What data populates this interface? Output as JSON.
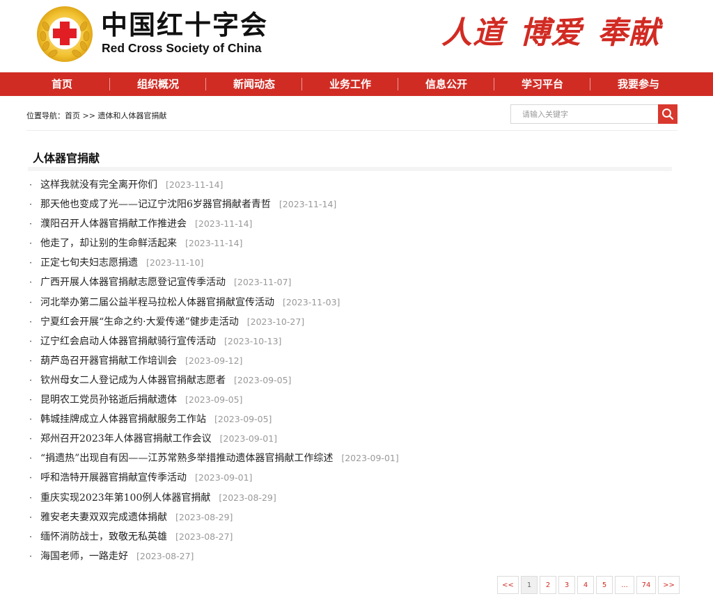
{
  "header": {
    "logo_cn": "中国红十字会",
    "logo_en": "Red Cross Society of China",
    "slogan": [
      "人道",
      "博爱",
      "奉献"
    ]
  },
  "nav": [
    "首页",
    "组织概况",
    "新闻动态",
    "业务工作",
    "信息公开",
    "学习平台",
    "我要参与"
  ],
  "breadcrumb": "位置导航：首页 >> 遗体和人体器官捐献",
  "search": {
    "placeholder": "请输入关键字"
  },
  "section_title": "人体器官捐献",
  "items": [
    {
      "title": "这样我就没有完全离开你们",
      "date": "[2023-11-14]"
    },
    {
      "title": "那天他也变成了光——记辽宁沈阳6岁器官捐献者青哲",
      "date": "[2023-11-14]"
    },
    {
      "title": "濮阳召开人体器官捐献工作推进会",
      "date": "[2023-11-14]"
    },
    {
      "title": "他走了，却让别的生命鲜活起来",
      "date": "[2023-11-14]"
    },
    {
      "title": "正定七旬夫妇志愿捐遗",
      "date": "[2023-11-10]"
    },
    {
      "title": "广西开展人体器官捐献志愿登记宣传季活动",
      "date": "[2023-11-07]"
    },
    {
      "title": "河北举办第二届公益半程马拉松人体器官捐献宣传活动",
      "date": "[2023-11-03]"
    },
    {
      "title": "宁夏红会开展“生命之约·大爱传递”健步走活动",
      "date": "[2023-10-27]"
    },
    {
      "title": "辽宁红会启动人体器官捐献骑行宣传活动",
      "date": "[2023-10-13]"
    },
    {
      "title": "葫芦岛召开器官捐献工作培训会",
      "date": "[2023-09-12]"
    },
    {
      "title": "钦州母女二人登记成为人体器官捐献志愿者",
      "date": "[2023-09-05]"
    },
    {
      "title": "昆明农工党员孙铭逝后捐献遗体",
      "date": "[2023-09-05]"
    },
    {
      "title": "韩城挂牌成立人体器官捐献服务工作站",
      "date": "[2023-09-05]"
    },
    {
      "title": "郑州召开2023年人体器官捐献工作会议",
      "date": "[2023-09-01]"
    },
    {
      "title": "“捐遗热”出现自有因——江苏常熟多举措推动遗体器官捐献工作综述",
      "date": "[2023-09-01]"
    },
    {
      "title": "呼和浩特开展器官捐献宣传季活动",
      "date": "[2023-09-01]"
    },
    {
      "title": "重庆实现2023年第100例人体器官捐献",
      "date": "[2023-08-29]"
    },
    {
      "title": "雅安老夫妻双双完成遗体捐献",
      "date": "[2023-08-29]"
    },
    {
      "title": "缅怀消防战士，致敬无私英雄",
      "date": "[2023-08-27]"
    },
    {
      "title": "海国老师，一路走好",
      "date": "[2023-08-27]"
    }
  ],
  "pagination": [
    "<<",
    "1",
    "2",
    "3",
    "4",
    "5",
    "...",
    "74",
    ">>"
  ],
  "pagination_current": "1",
  "colors": {
    "brand_red": "#d02c24",
    "date_gray": "#999999"
  }
}
